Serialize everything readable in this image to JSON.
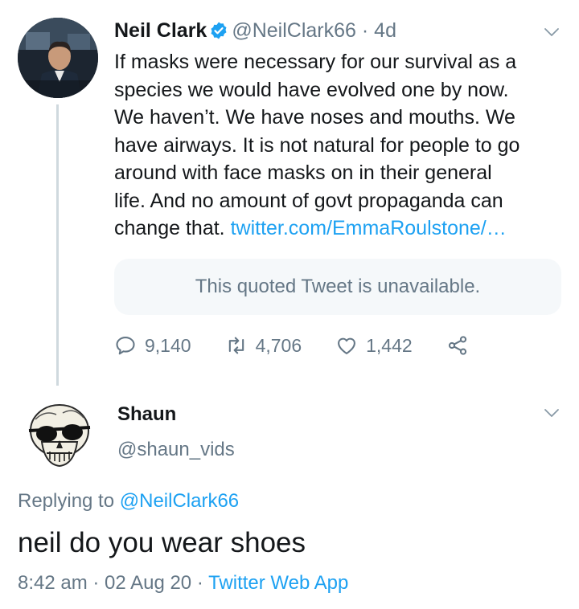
{
  "colors": {
    "text": "#14171a",
    "secondary": "#657786",
    "link": "#1da1f2",
    "quote_bg": "#f5f8fa",
    "thread_line": "#cfd9de"
  },
  "tweet": {
    "author_name": "Neil Clark",
    "verified_icon": "verified-badge-icon",
    "handle": "@NeilClark66",
    "separator": "·",
    "age": "4d",
    "text_lines": [
      "If masks were necessary for our survival as a",
      "species we would have evolved one by now.",
      "We haven’t. We have noses and mouths. We",
      "have airways. It is not natural for people to go",
      "around with face masks on in their general",
      "life. And no amount of govt propaganda can",
      "change that. "
    ],
    "link_text": "twitter.com/EmmaRoulstone/…",
    "quote_unavailable": "This quoted Tweet is unavailable.",
    "replies": "9,140",
    "retweets": "4,706",
    "likes": "1,442",
    "icons": [
      "reply-icon",
      "retweet-icon",
      "like-icon",
      "share-icon",
      "chevron-down-icon"
    ]
  },
  "reply": {
    "author_name": "Shaun",
    "handle": "@shaun_vids",
    "replying_prefix": "Replying to ",
    "replying_handle": "@NeilClark66",
    "text": "neil do you wear shoes",
    "time": "8:42 am",
    "sep": " · ",
    "date": "02 Aug 20",
    "sep2": " · ",
    "source": "Twitter Web App"
  }
}
